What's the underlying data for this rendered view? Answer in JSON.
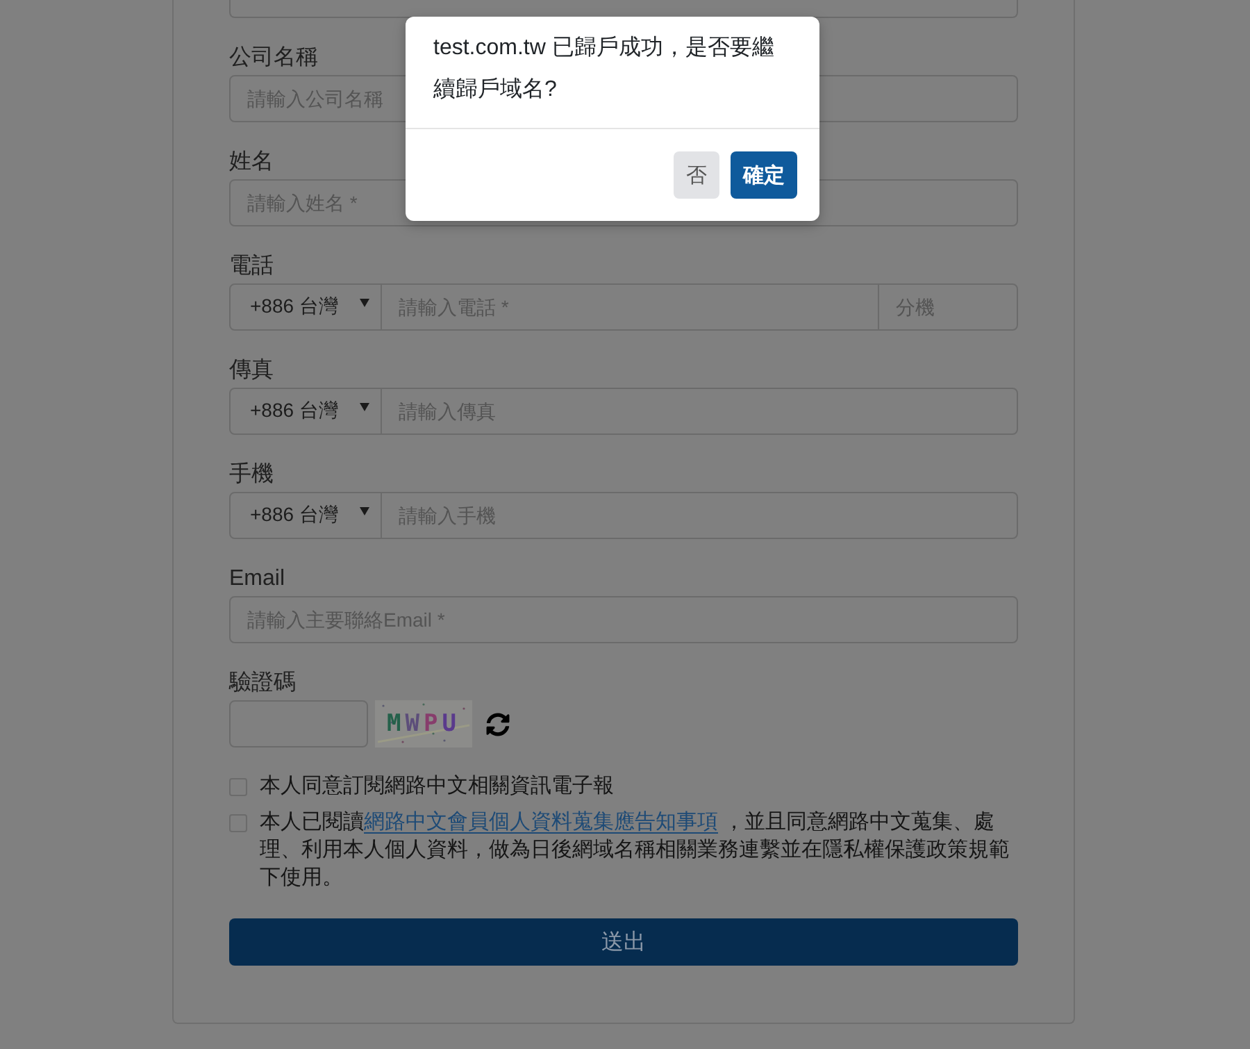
{
  "form": {
    "fields": [
      {
        "kind": "text",
        "label": "公司名稱",
        "placeholder": "請輸入公司名稱"
      },
      {
        "kind": "text",
        "label": "姓名",
        "placeholder": "請輸入姓名 *"
      },
      {
        "kind": "phone",
        "label": "電話",
        "country_code": "+886 台灣",
        "placeholder": "請輸入電話 *",
        "extension_placeholder": "分機"
      },
      {
        "kind": "phone",
        "label": "傳真",
        "country_code": "+886 台灣",
        "placeholder": "請輸入傳真"
      },
      {
        "kind": "phone",
        "label": "手機",
        "country_code": "+886 台灣",
        "placeholder": "請輸入手機"
      },
      {
        "kind": "text",
        "label": "Email",
        "placeholder": "請輸入主要聯絡Email *"
      },
      {
        "kind": "captcha",
        "label": "驗證碼",
        "captcha_text": "MWPU"
      }
    ],
    "agreements": [
      {
        "checked": false,
        "text": "本人同意訂閱網路中文相關資訊電子報"
      },
      {
        "checked": false,
        "text": "本人已閱讀",
        "link": "網路中文會員個人資料蒐集應告知事項",
        "text_after": " ，並且同意網路中文蒐集、處理、利用本人個人資料，做為日後網域名稱相關業務連繫並在隱私權保護政策規範下使用。"
      }
    ],
    "submit_button": "送出"
  },
  "dialog": {
    "message": "test.com.tw 已歸戶成功，是否要繼續歸戶域名?",
    "buttons": [
      {
        "label": "否",
        "kind": "secondary"
      },
      {
        "label": "確定",
        "kind": "primary"
      }
    ]
  }
}
